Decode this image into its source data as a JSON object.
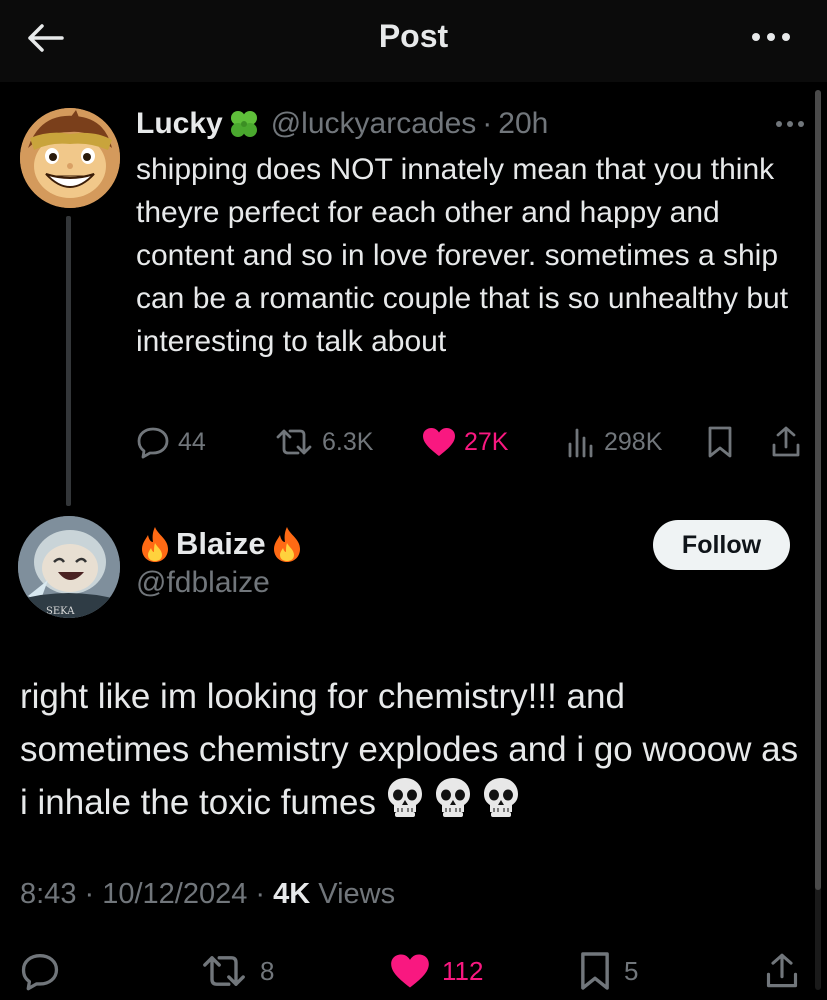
{
  "header": {
    "title": "Post",
    "back_icon": "arrow-left-icon",
    "more_icon": "more-horizontal-icon"
  },
  "parent_post": {
    "author_name": "Lucky",
    "author_emoji": "four-leaf-clover-icon",
    "handle": "@luckyarcades",
    "separator": "·",
    "time": "20h",
    "text": "shipping does NOT innately mean that you think theyre perfect for each other and happy and content and so in love forever. sometimes a ship can be a romantic couple that is so unhealthy but interesting to talk about",
    "replies": "44",
    "reposts": "6.3K",
    "likes": "27K",
    "views": "298K"
  },
  "reply_post": {
    "author_name": "Blaize",
    "author_emoji": "fire-icon",
    "handle": "@fdblaize",
    "follow_label": "Follow",
    "avatar_text": "SEKA",
    "text": "right like im looking for chemistry!!! and sometimes chemistry explodes and i go wooow as i inhale the toxic fumes",
    "emoji": [
      "skull-icon",
      "skull-icon",
      "skull-icon"
    ],
    "timestamp": "8:43 · 10/12/2024 · ",
    "views_count": "4K",
    "views_label": " Views",
    "reposts": "8",
    "likes": "112",
    "bookmarks": "5"
  },
  "colors": {
    "background": "#000000",
    "text": "#e7e9ea",
    "muted": "#71767b",
    "like": "#f91880",
    "follow_bg": "#eff3f4"
  }
}
